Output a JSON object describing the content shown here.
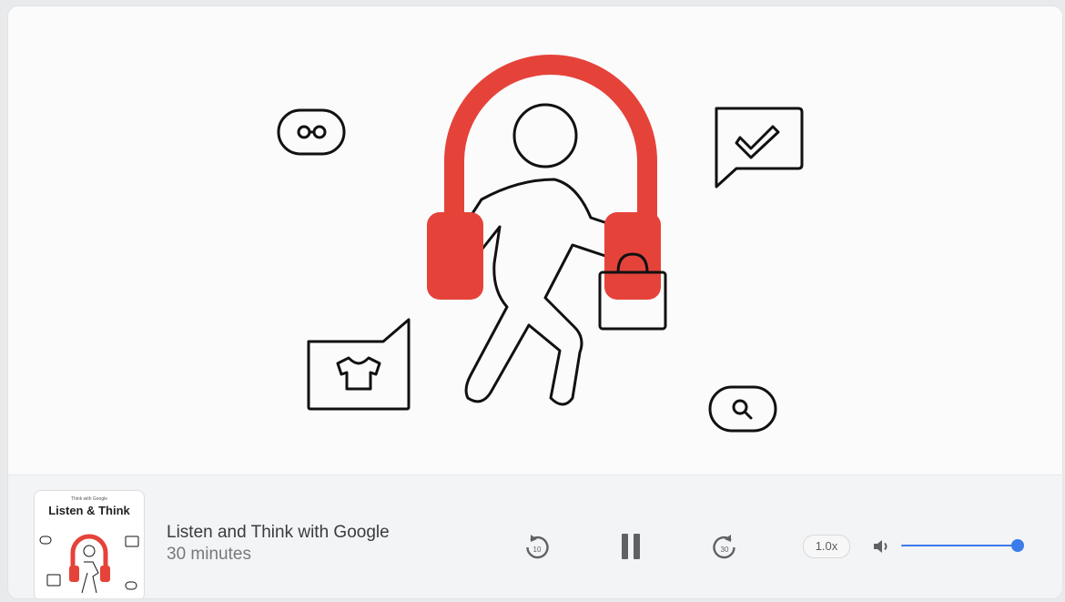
{
  "player": {
    "thumbnail": {
      "caption": "Think with Google",
      "title": "Listen & Think"
    },
    "episode_title": "Listen and Think with Google",
    "episode_duration": "30 minutes",
    "rewind_label": "10",
    "forward_label": "30",
    "speed_label": "1.0x",
    "volume_level": 1.0
  },
  "colors": {
    "accent_red": "#e5433a",
    "slider_blue": "#3b7bea",
    "line": "#111111"
  },
  "icons": [
    "glasses-icon",
    "checkmark-chat-icon",
    "tshirt-chat-icon",
    "search-icon",
    "headphones-icon",
    "walking-person-icon",
    "shopping-bag-icon"
  ]
}
